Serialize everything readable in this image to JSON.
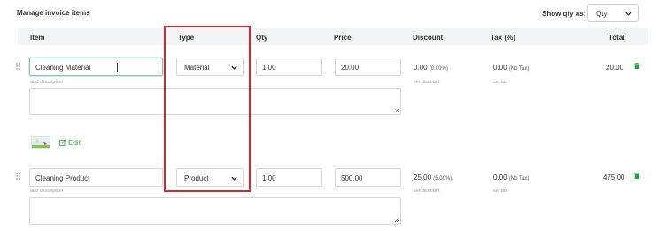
{
  "header": {
    "title": "Manage invoice items",
    "show_qty_label": "Show qty as:",
    "show_qty_value": "Qty"
  },
  "columns": {
    "item": "Item",
    "type": "Type",
    "qty": "Qty",
    "price": "Price",
    "discount": "Discount",
    "tax": "Tax (%)",
    "total": "Total"
  },
  "rows": [
    {
      "item": "Cleaning Material",
      "add_description": "add description",
      "type": "Material",
      "qty": "1.00",
      "price": "20.00",
      "discount": "0.00",
      "discount_pct": "(0.00%)",
      "set_discount": "set discount",
      "tax": "0.00",
      "tax_note": "(No Tax)",
      "set_tax": "set tax",
      "total": "20.00",
      "edit_label": "Edit"
    },
    {
      "item": "Cleaning Product",
      "add_description": "add description",
      "type": "Product",
      "qty": "1.00",
      "price": "500.00",
      "discount": "25.00",
      "discount_pct": "(5.00%)",
      "set_discount": "set discount",
      "tax": "0.00",
      "tax_note": "(No Tax)",
      "set_tax": "set tax",
      "total": "475.00"
    }
  ],
  "colors": {
    "accent_green": "#27a543",
    "highlight_red": "#d9262d",
    "focus_teal": "#7fc6b6",
    "header_bg": "#f3f4f6"
  },
  "icons": {
    "drag": "drag-handle-icon",
    "delete": "trash-icon",
    "edit": "edit-icon",
    "dropdown": "chevron-down-icon",
    "resize": "resize-handle-icon"
  }
}
